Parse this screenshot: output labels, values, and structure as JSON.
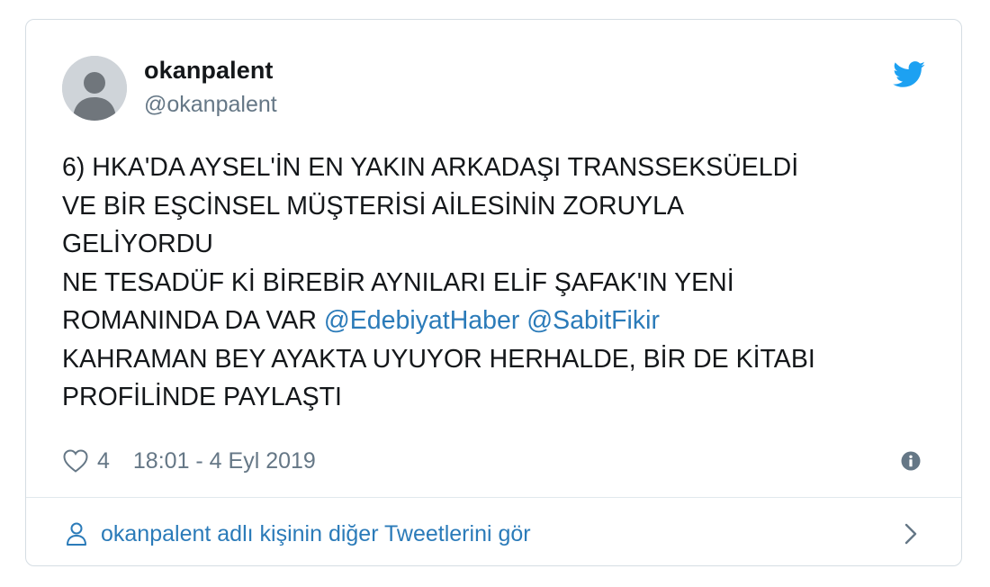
{
  "user": {
    "display_name": "okanpalent",
    "handle": "@okanpalent",
    "avatar": "default-avatar-silhouette"
  },
  "tweet": {
    "lines": [
      [
        "6) HKA'DA AYSEL'İN EN YAKIN ARKADAŞI TRANSSEKSÜELDİ"
      ],
      [
        "VE BİR EŞCİNSEL MÜŞTERİSİ AİLESİNİN ZORUYLA"
      ],
      [
        "GELİYORDU"
      ],
      [
        "NE TESADÜF Kİ BİREBİR AYNILARI ELİF ŞAFAK'IN YENİ"
      ],
      [
        "ROMANINDA DA VAR ",
        "@EdebiyatHaber",
        " ",
        "@SabitFikir"
      ],
      [
        "KAHRAMAN BEY AYAKTA UYUYOR HERHALDE, BİR DE KİTABI"
      ],
      [
        "PROFİLİNDE PAYLAŞTI"
      ]
    ]
  },
  "meta": {
    "like_count": "4",
    "timestamp": "18:01 - 4 Eyl 2019"
  },
  "footer": {
    "more_tweets_label": "okanpalent adlı kişinin diğer Tweetlerini gör"
  },
  "icons": {
    "brand": "twitter-bird-icon",
    "like": "heart-icon",
    "info": "info-icon",
    "person": "person-icon",
    "chevron": "chevron-right-icon"
  },
  "colors": {
    "text": "#14171a",
    "secondary": "#657786",
    "link": "#2b7bb9",
    "twitter_blue": "#1da1f2",
    "border": "#d5dde3"
  }
}
